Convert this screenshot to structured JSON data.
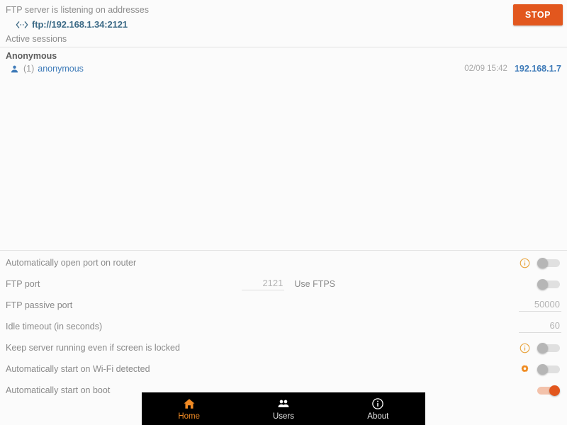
{
  "server": {
    "listening_label": "FTP server is listening on addresses",
    "url": "ftp://192.168.1.34:2121",
    "link_icon": "link-arrows-icon",
    "stop_label": "STOP"
  },
  "sessions": {
    "header": "Active sessions",
    "groups": [
      {
        "title": "Anonymous",
        "rows": [
          {
            "icon": "person-icon",
            "count": "(1)",
            "user": "anonymous",
            "time": "02/09 15:42",
            "ip": "192.168.1.7"
          }
        ]
      }
    ]
  },
  "settings": {
    "rows": [
      {
        "label": "Automatically open port on router",
        "type": "toggle",
        "icon": "info-icon",
        "value": "off"
      },
      {
        "label": "FTP port",
        "type": "number-with-toggle",
        "value": "2121",
        "secondary_label": "Use FTPS",
        "toggle": "off"
      },
      {
        "label": "FTP passive port",
        "type": "number",
        "value": "50000"
      },
      {
        "label": "Idle timeout (in seconds)",
        "type": "number",
        "value": "60"
      },
      {
        "label": "Keep server running even if screen is locked",
        "type": "toggle",
        "icon": "info-icon",
        "value": "off"
      },
      {
        "label": "Automatically start on Wi-Fi detected",
        "type": "toggle",
        "icon": "gear-icon",
        "value": "off"
      },
      {
        "label": "Automatically start on boot",
        "type": "toggle",
        "icon": "",
        "value": "on"
      }
    ]
  },
  "bottom_nav": {
    "items": [
      {
        "label": "Home",
        "icon": "home-icon",
        "active": true
      },
      {
        "label": "Users",
        "icon": "users-icon",
        "active": false
      },
      {
        "label": "About",
        "icon": "info-icon",
        "active": false
      }
    ]
  },
  "colors": {
    "accent": "#e2571e",
    "link": "#3d7ab8",
    "url": "#3d6b87",
    "nav_active": "#f08a24",
    "nav_bg": "#000000",
    "text": "#8a8a8a"
  }
}
